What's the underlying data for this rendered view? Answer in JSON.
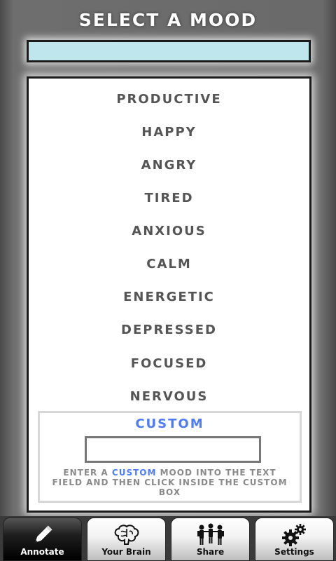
{
  "header": {
    "title": "SELECT A MOOD"
  },
  "mood_display": {
    "value": ""
  },
  "moods": [
    "PRODUCTIVE",
    "HAPPY",
    "ANGRY",
    "TIRED",
    "ANXIOUS",
    "CALM",
    "ENERGETIC",
    "DEPRESSED",
    "FOCUSED",
    "NERVOUS"
  ],
  "custom": {
    "title": "CUSTOM",
    "input_value": "",
    "help_part1": "ENTER A ",
    "help_highlight": "CUSTOM",
    "help_part2": " MOOD INTO THE TEXT FIELD AND THEN CLICK INSIDE THE CUSTOM BOX"
  },
  "tabs": [
    {
      "label": "Annotate",
      "icon": "pencil-icon",
      "active": true
    },
    {
      "label": "Your Brain",
      "icon": "brain-icon",
      "active": false
    },
    {
      "label": "Share",
      "icon": "people-icon",
      "active": false
    },
    {
      "label": "Settings",
      "icon": "gears-icon",
      "active": false
    }
  ],
  "colors": {
    "accent": "#4c7bff",
    "display_field": "#bfe6ec",
    "mood_text": "#555555"
  }
}
